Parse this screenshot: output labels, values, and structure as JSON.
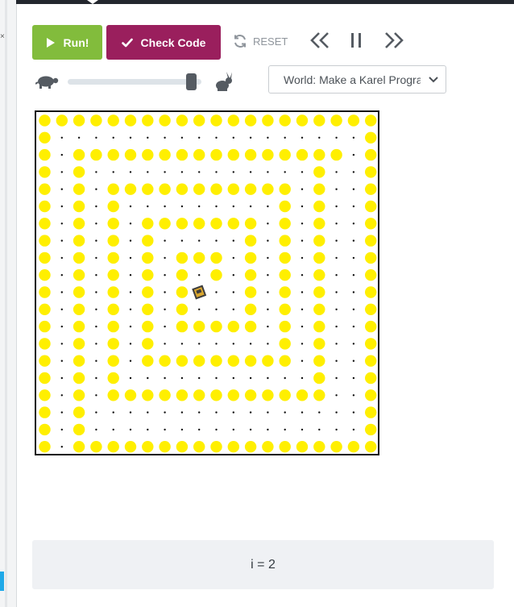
{
  "toolbar": {
    "run_label": "Run!",
    "check_label": "Check Code",
    "reset_label": "RESET",
    "icons": {
      "run": "play-icon",
      "check": "checkmark-icon",
      "reset": "refresh-icon",
      "back": "double-chevron-left-icon",
      "pause": "pause-icon",
      "forward": "double-chevron-right-icon",
      "slow": "turtle-icon",
      "fast": "rabbit-icon"
    }
  },
  "speed": {
    "level": 0.96
  },
  "world": {
    "selected": "World: Make a Karel Program"
  },
  "colors": {
    "run": "#82bc3c",
    "check": "#9a1f5d",
    "ball": "#ffef00",
    "dot": "#111111"
  },
  "grid": {
    "size": 20,
    "rows": [
      "BBBBBBBBBBBBBBBBBBBB",
      "B..................B",
      "B.BBBBBBBBBBBBBBBB.B",
      "B.B.............B..B",
      "B.B.BBBBBBBBBBB.B..B",
      "B.B.B.........B.B..B",
      "B.B.B.BBBBBBB.B.B..B",
      "B.B.B.B.....B.B.B..B",
      "B.B.B.B.BBB.B.B.B..B",
      "B.B.B.B.B.B.B.B.B..B",
      "B.B.B.B.BK..B.B.B..B",
      "B.B.B.B.B...B.B.B..B",
      "B.B.B.B.BBBBB.B.B..B",
      "B.B.B.B.......B.B..B",
      "B.B.B.BBBBBBBBB.B..B",
      "B.B.B...........B..B",
      "B.B.BBBBBBBBBBBBB..B",
      "B.B................B",
      "B.B................B",
      "B.BBBBBBBBBBBBBBBBBB"
    ]
  },
  "output": {
    "text": "i = 2"
  }
}
